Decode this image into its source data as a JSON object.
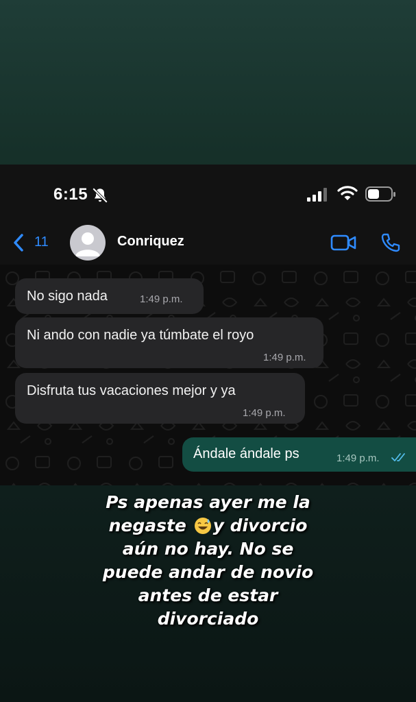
{
  "status_bar": {
    "time": "6:15"
  },
  "header": {
    "back_count": "11",
    "contact_name": "Conriquez"
  },
  "messages": [
    {
      "text": "No sigo nada",
      "time": "1:49 p.m.",
      "direction": "incoming"
    },
    {
      "text": "Ni ando con nadie ya túmbate el royo",
      "time": "1:49 p.m.",
      "direction": "incoming"
    },
    {
      "text": "Disfruta tus vacaciones mejor y ya",
      "time": "1:49 p.m.",
      "direction": "incoming"
    },
    {
      "text": "Ándale ándale ps",
      "time": "1:49 p.m.",
      "direction": "outgoing",
      "status": "read"
    }
  ],
  "caption": {
    "lines": [
      "Ps apenas ayer me la",
      "negaste",
      "y divorcio",
      "aún no hay. No se",
      "puede andar de novio",
      "antes de estar",
      "divorciado"
    ],
    "emoji": "sweat-smile-emoji"
  },
  "colors": {
    "accent": "#2f8bff",
    "incoming_bubble": "#262628",
    "outgoing_bubble": "#134d43",
    "background_top": "#1f3d37"
  },
  "icons": [
    "bell-slash-icon",
    "signal-icon",
    "wifi-icon",
    "battery-icon",
    "back-chevron-icon",
    "video-call-icon",
    "phone-icon",
    "double-check-icon"
  ]
}
